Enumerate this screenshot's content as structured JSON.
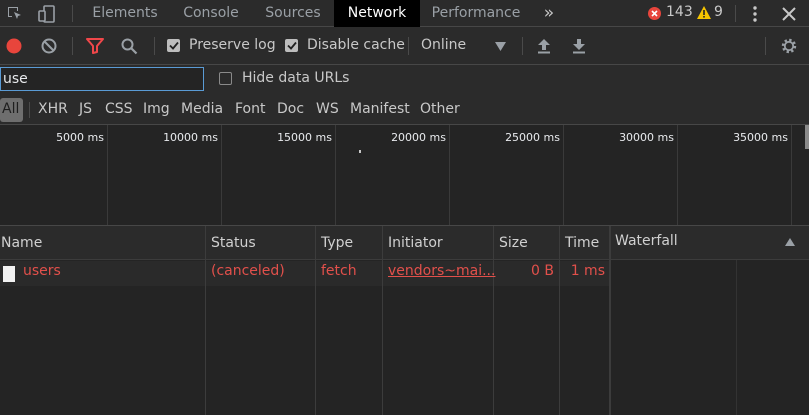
{
  "tabs": {
    "elements": "Elements",
    "console": "Console",
    "sources": "Sources",
    "network": "Network",
    "performance": "Performance",
    "more": "»"
  },
  "status": {
    "errors": "143",
    "warnings": "9"
  },
  "toolbar": {
    "preserve_log": "Preserve log",
    "disable_cache": "Disable cache",
    "throttling": "Online"
  },
  "filter": {
    "value": "use",
    "hide_data_urls": "Hide data URLs"
  },
  "types": [
    "All",
    "XHR",
    "JS",
    "CSS",
    "Img",
    "Media",
    "Font",
    "Doc",
    "WS",
    "Manifest",
    "Other"
  ],
  "timeline": [
    "5000 ms",
    "10000 ms",
    "15000 ms",
    "20000 ms",
    "25000 ms",
    "30000 ms",
    "35000 ms"
  ],
  "columns": {
    "name": "Name",
    "status": "Status",
    "type": "Type",
    "initiator": "Initiator",
    "size": "Size",
    "time": "Time",
    "waterfall": "Waterfall"
  },
  "requests": [
    {
      "name": "users",
      "status": "(canceled)",
      "type": "fetch",
      "initiator": "vendors~mai...",
      "size": "0 B",
      "time": "1 ms"
    }
  ],
  "colors": {
    "accent_record": "#e8453c",
    "filter_active": "#f0474a",
    "error_text": "#e2504b",
    "warning": "#f5c400"
  }
}
